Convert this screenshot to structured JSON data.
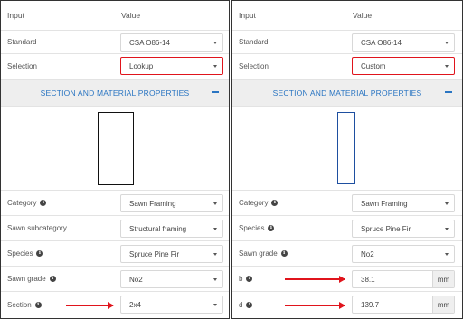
{
  "left": {
    "header": {
      "input": "Input",
      "value": "Value"
    },
    "standard": {
      "label": "Standard",
      "value": "CSA O86-14"
    },
    "selection": {
      "label": "Selection",
      "value": "Lookup"
    },
    "section_title": "SECTION AND MATERIAL PROPERTIES",
    "category": {
      "label": "Category",
      "value": "Sawn Framing"
    },
    "subcategory": {
      "label": "Sawn subcategory",
      "value": "Structural framing"
    },
    "species": {
      "label": "Species",
      "value": "Spruce Pine Fir"
    },
    "grade": {
      "label": "Sawn grade",
      "value": "No2"
    },
    "section": {
      "label": "Section",
      "value": "2x4"
    }
  },
  "right": {
    "header": {
      "input": "Input",
      "value": "Value"
    },
    "standard": {
      "label": "Standard",
      "value": "CSA O86-14"
    },
    "selection": {
      "label": "Selection",
      "value": "Custom"
    },
    "section_title": "SECTION AND MATERIAL PROPERTIES",
    "category": {
      "label": "Category",
      "value": "Sawn Framing"
    },
    "species": {
      "label": "Species",
      "value": "Spruce Pine Fir"
    },
    "grade": {
      "label": "Sawn grade",
      "value": "No2"
    },
    "b": {
      "label": "b",
      "value": "38.1",
      "unit": "mm"
    },
    "d": {
      "label": "d",
      "value": "139.7",
      "unit": "mm"
    }
  },
  "colors": {
    "accent": "#2a75c2",
    "highlight": "#e0141c",
    "section_outline_custom": "#1e4fa0"
  },
  "icons": {
    "info": "info-icon",
    "caret": "chevron-down-icon",
    "collapse": "minus-icon"
  }
}
